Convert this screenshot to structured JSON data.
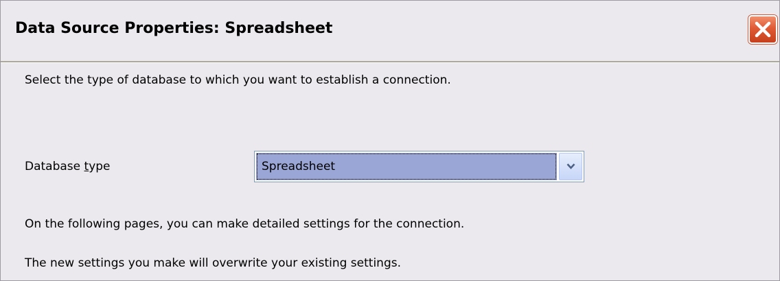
{
  "dialog": {
    "title": "Data Source Properties: Spreadsheet",
    "close_icon": "close-x-icon",
    "instruction": "Select the type of database to which you want to establish a connection.",
    "database_type": {
      "label_prefix": "Database ",
      "label_mnemonic": "t",
      "label_suffix": "ype",
      "selected_value": "Spreadsheet",
      "dropdown_icon": "chevron-down-icon"
    },
    "info_line_1": "On the following pages, you can make detailed settings for the connection.",
    "info_line_2": "The new settings you make will overwrite your existing settings."
  },
  "colors": {
    "dialog_background": "#ebe9ed",
    "close_button": "#e05a35",
    "selection_highlight": "#9aa6d6"
  }
}
